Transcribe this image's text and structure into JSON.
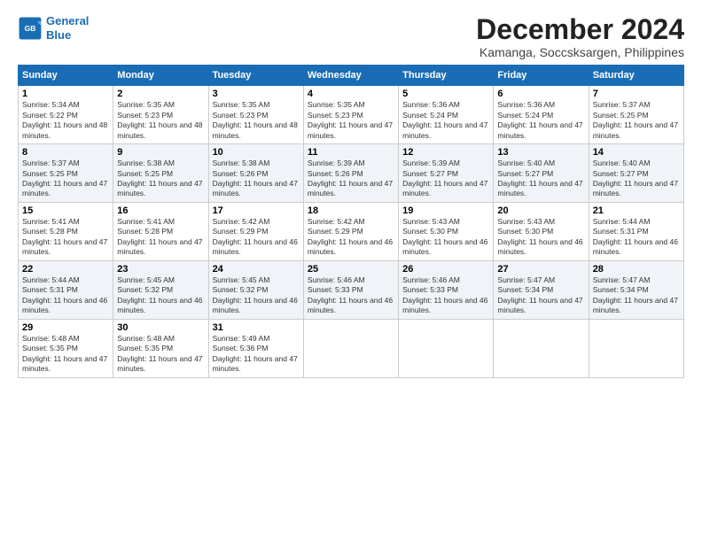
{
  "logo": {
    "line1": "General",
    "line2": "Blue"
  },
  "title": "December 2024",
  "subtitle": "Kamanga, Soccsksargen, Philippines",
  "headers": [
    "Sunday",
    "Monday",
    "Tuesday",
    "Wednesday",
    "Thursday",
    "Friday",
    "Saturday"
  ],
  "weeks": [
    [
      {
        "day": "1",
        "sunrise": "5:34 AM",
        "sunset": "5:22 PM",
        "daylight": "11 hours and 48 minutes."
      },
      {
        "day": "2",
        "sunrise": "5:35 AM",
        "sunset": "5:23 PM",
        "daylight": "11 hours and 48 minutes."
      },
      {
        "day": "3",
        "sunrise": "5:35 AM",
        "sunset": "5:23 PM",
        "daylight": "11 hours and 48 minutes."
      },
      {
        "day": "4",
        "sunrise": "5:35 AM",
        "sunset": "5:23 PM",
        "daylight": "11 hours and 47 minutes."
      },
      {
        "day": "5",
        "sunrise": "5:36 AM",
        "sunset": "5:24 PM",
        "daylight": "11 hours and 47 minutes."
      },
      {
        "day": "6",
        "sunrise": "5:36 AM",
        "sunset": "5:24 PM",
        "daylight": "11 hours and 47 minutes."
      },
      {
        "day": "7",
        "sunrise": "5:37 AM",
        "sunset": "5:25 PM",
        "daylight": "11 hours and 47 minutes."
      }
    ],
    [
      {
        "day": "8",
        "sunrise": "5:37 AM",
        "sunset": "5:25 PM",
        "daylight": "11 hours and 47 minutes."
      },
      {
        "day": "9",
        "sunrise": "5:38 AM",
        "sunset": "5:25 PM",
        "daylight": "11 hours and 47 minutes."
      },
      {
        "day": "10",
        "sunrise": "5:38 AM",
        "sunset": "5:26 PM",
        "daylight": "11 hours and 47 minutes."
      },
      {
        "day": "11",
        "sunrise": "5:39 AM",
        "sunset": "5:26 PM",
        "daylight": "11 hours and 47 minutes."
      },
      {
        "day": "12",
        "sunrise": "5:39 AM",
        "sunset": "5:27 PM",
        "daylight": "11 hours and 47 minutes."
      },
      {
        "day": "13",
        "sunrise": "5:40 AM",
        "sunset": "5:27 PM",
        "daylight": "11 hours and 47 minutes."
      },
      {
        "day": "14",
        "sunrise": "5:40 AM",
        "sunset": "5:27 PM",
        "daylight": "11 hours and 47 minutes."
      }
    ],
    [
      {
        "day": "15",
        "sunrise": "5:41 AM",
        "sunset": "5:28 PM",
        "daylight": "11 hours and 47 minutes."
      },
      {
        "day": "16",
        "sunrise": "5:41 AM",
        "sunset": "5:28 PM",
        "daylight": "11 hours and 47 minutes."
      },
      {
        "day": "17",
        "sunrise": "5:42 AM",
        "sunset": "5:29 PM",
        "daylight": "11 hours and 46 minutes."
      },
      {
        "day": "18",
        "sunrise": "5:42 AM",
        "sunset": "5:29 PM",
        "daylight": "11 hours and 46 minutes."
      },
      {
        "day": "19",
        "sunrise": "5:43 AM",
        "sunset": "5:30 PM",
        "daylight": "11 hours and 46 minutes."
      },
      {
        "day": "20",
        "sunrise": "5:43 AM",
        "sunset": "5:30 PM",
        "daylight": "11 hours and 46 minutes."
      },
      {
        "day": "21",
        "sunrise": "5:44 AM",
        "sunset": "5:31 PM",
        "daylight": "11 hours and 46 minutes."
      }
    ],
    [
      {
        "day": "22",
        "sunrise": "5:44 AM",
        "sunset": "5:31 PM",
        "daylight": "11 hours and 46 minutes."
      },
      {
        "day": "23",
        "sunrise": "5:45 AM",
        "sunset": "5:32 PM",
        "daylight": "11 hours and 46 minutes."
      },
      {
        "day": "24",
        "sunrise": "5:45 AM",
        "sunset": "5:32 PM",
        "daylight": "11 hours and 46 minutes."
      },
      {
        "day": "25",
        "sunrise": "5:46 AM",
        "sunset": "5:33 PM",
        "daylight": "11 hours and 46 minutes."
      },
      {
        "day": "26",
        "sunrise": "5:46 AM",
        "sunset": "5:33 PM",
        "daylight": "11 hours and 46 minutes."
      },
      {
        "day": "27",
        "sunrise": "5:47 AM",
        "sunset": "5:34 PM",
        "daylight": "11 hours and 47 minutes."
      },
      {
        "day": "28",
        "sunrise": "5:47 AM",
        "sunset": "5:34 PM",
        "daylight": "11 hours and 47 minutes."
      }
    ],
    [
      {
        "day": "29",
        "sunrise": "5:48 AM",
        "sunset": "5:35 PM",
        "daylight": "11 hours and 47 minutes."
      },
      {
        "day": "30",
        "sunrise": "5:48 AM",
        "sunset": "5:35 PM",
        "daylight": "11 hours and 47 minutes."
      },
      {
        "day": "31",
        "sunrise": "5:49 AM",
        "sunset": "5:36 PM",
        "daylight": "11 hours and 47 minutes."
      },
      null,
      null,
      null,
      null
    ]
  ]
}
